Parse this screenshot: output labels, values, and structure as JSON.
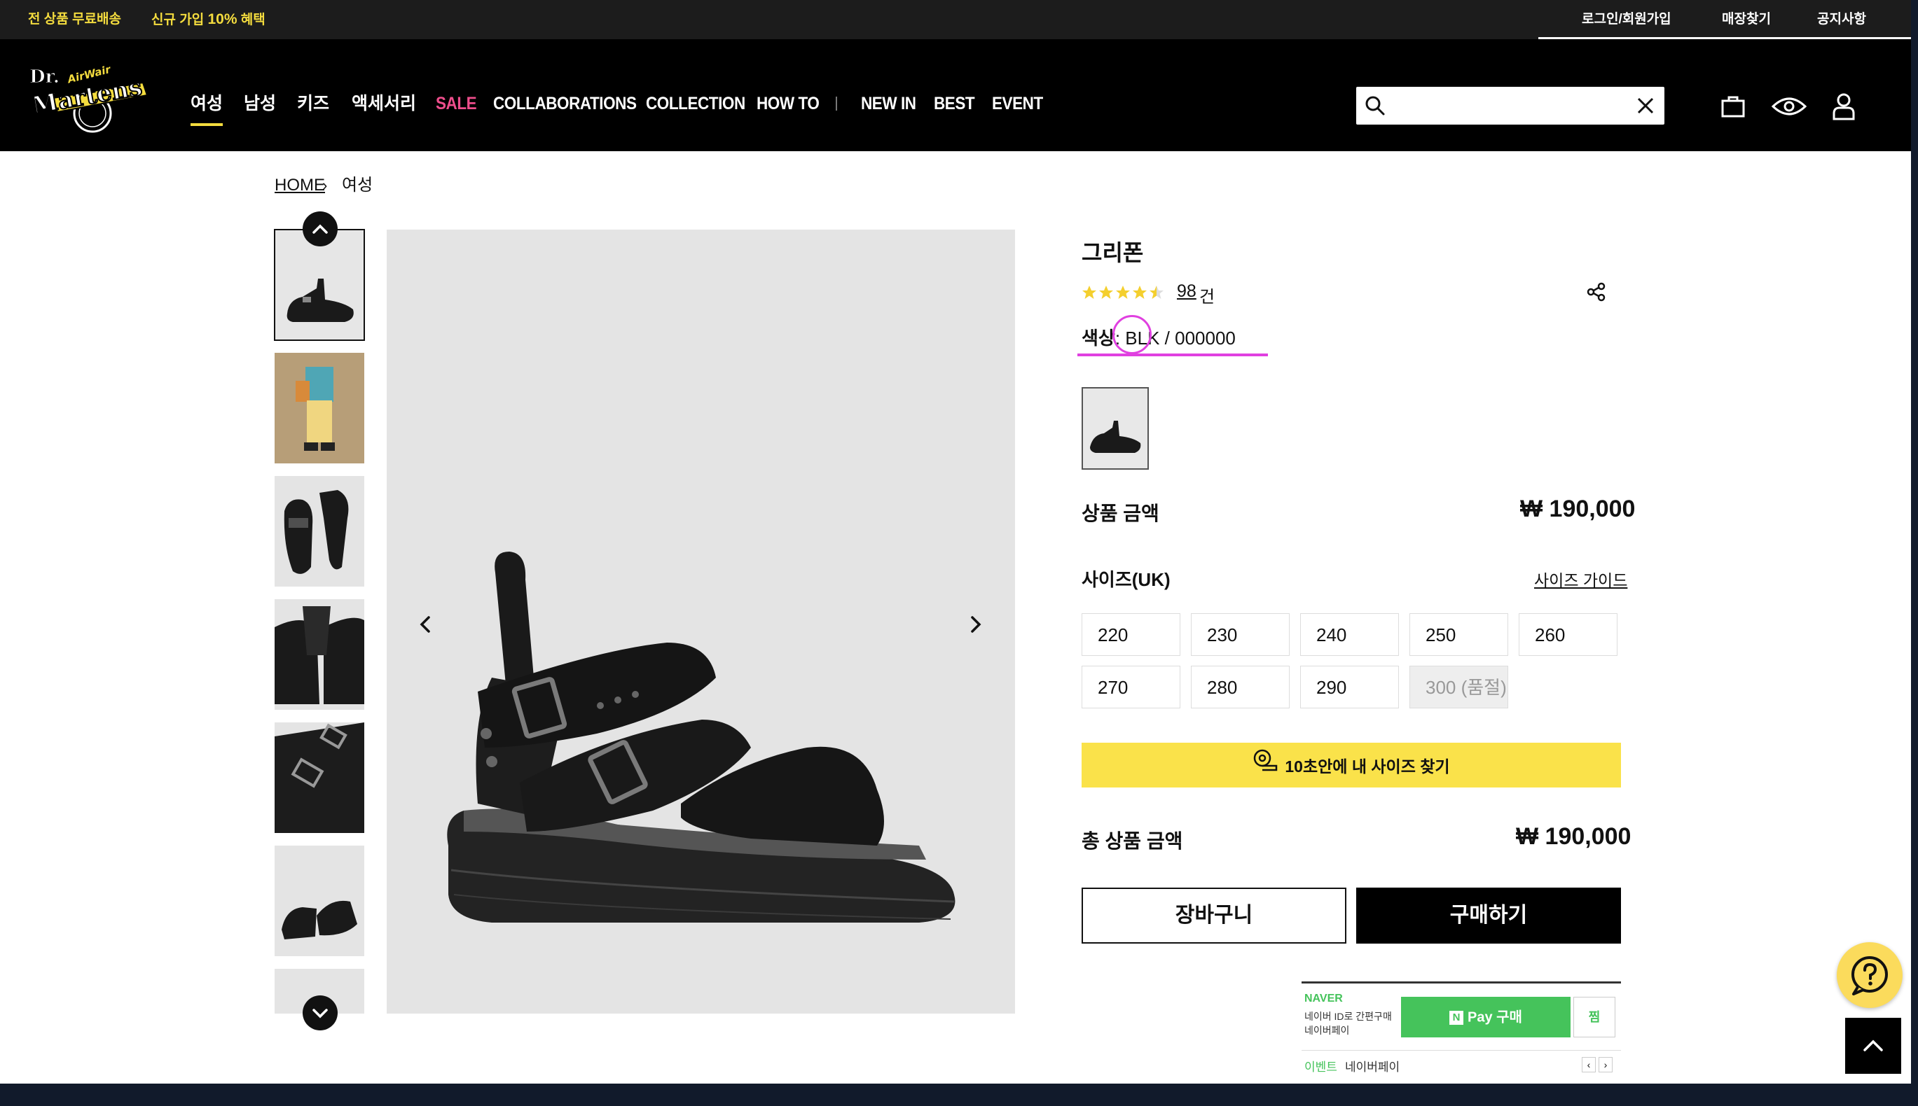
{
  "promo": {
    "free_shipping": "전 상품 무료배송",
    "signup_prefix": "신규 가입 ",
    "signup_pct": "10%",
    "signup_suffix": " 혜택"
  },
  "utility": {
    "login": "로그인/회원가입",
    "store": "매장찾기",
    "notice": "공지사항"
  },
  "brand": {
    "logo_text_1": "Dr.",
    "logo_text_2": "Martens",
    "logo_tag": "AirWair"
  },
  "nav": {
    "items": [
      "여성",
      "남성",
      "키즈",
      "액세서리",
      "SALE",
      "COLLABORATIONS",
      "COLLECTION",
      "HOW TO",
      "NEW IN",
      "BEST",
      "EVENT"
    ]
  },
  "search": {
    "placeholder": ""
  },
  "breadcrumb": {
    "home": "HOME",
    "current": "여성"
  },
  "product": {
    "name": "그리폰",
    "rating": 4.5,
    "review_count": "98",
    "review_unit": "건",
    "color_label": "색상",
    "color_value": "BLK",
    "color_code": " / 000000",
    "price_label": "상품 금액",
    "price": "₩ 190,000",
    "size_label": "사이즈(UK)",
    "size_guide": "사이즈 가이드",
    "sizes": [
      "220",
      "230",
      "240",
      "250",
      "260",
      "270",
      "280",
      "290",
      "300 (품절)"
    ],
    "sold_out_size": "300 (품절)",
    "size_finder": "10초안에 내 사이즈 찾기",
    "total_label": "총 상품 금액",
    "total_price": "₩ 190,000",
    "cart": "장바구니",
    "buy": "구매하기"
  },
  "naver": {
    "brand": "NAVER",
    "desc_line1": "네이버 ID로 간편구매",
    "desc_line2": "네이버페이",
    "pay_n": "N",
    "pay_label": "Pay 구매",
    "zzim": "찜",
    "event": "이벤트",
    "event_text": "네이버페이"
  },
  "colors": {
    "accent_yellow": "#f4dc3e",
    "sale_pink": "#ee4e8c",
    "npay_green": "#45c35b",
    "highlight_magenta": "#e040e0"
  }
}
